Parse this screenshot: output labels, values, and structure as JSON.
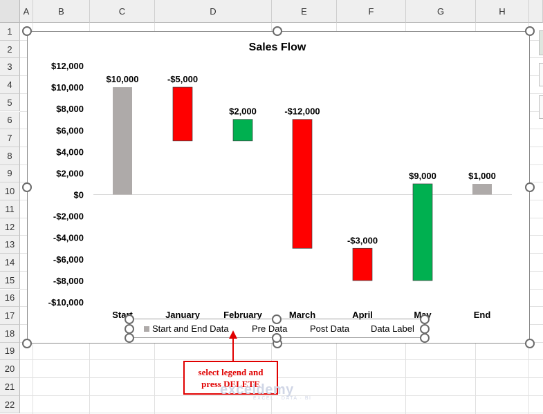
{
  "spreadsheet": {
    "columns": [
      "A",
      "B",
      "C",
      "D",
      "E",
      "F",
      "G",
      "H"
    ],
    "rows": [
      "1",
      "2",
      "3",
      "4",
      "5",
      "6",
      "7",
      "8",
      "9",
      "10",
      "11",
      "12",
      "13",
      "14",
      "15",
      "16",
      "17",
      "18",
      "19",
      "20",
      "21",
      "22"
    ]
  },
  "chart": {
    "title": "Sales Flow",
    "legend": [
      "Start and End Data",
      "Pre Data",
      "Post Data",
      "Data Label"
    ],
    "colors": {
      "total": "#aeaaa9",
      "negative": "#ff0000",
      "positive": "#00b050",
      "baseline": "#d9d9d9"
    }
  },
  "chart_data": {
    "type": "bar",
    "categories": [
      "Start",
      "January",
      "February",
      "March",
      "April",
      "May",
      "End"
    ],
    "bars": [
      {
        "category": "Start",
        "from": 0,
        "to": 10000,
        "kind": "total",
        "label": "$10,000"
      },
      {
        "category": "January",
        "from": 5000,
        "to": 10000,
        "kind": "negative",
        "label": "-$5,000"
      },
      {
        "category": "February",
        "from": 5000,
        "to": 7000,
        "kind": "positive",
        "label": "$2,000"
      },
      {
        "category": "March",
        "from": -5000,
        "to": 7000,
        "kind": "negative",
        "label": "-$12,000"
      },
      {
        "category": "April",
        "from": -8000,
        "to": -5000,
        "kind": "negative",
        "label": "-$3,000"
      },
      {
        "category": "May",
        "from": -8000,
        "to": 1000,
        "kind": "positive",
        "label": "$9,000"
      },
      {
        "category": "End",
        "from": 0,
        "to": 1000,
        "kind": "total",
        "label": "$1,000"
      }
    ],
    "yticks": [
      12000,
      10000,
      8000,
      6000,
      4000,
      2000,
      0,
      -2000,
      -4000,
      -6000,
      -8000,
      -10000
    ],
    "ytick_labels": [
      "$12,000",
      "$10,000",
      "$8,000",
      "$6,000",
      "$4,000",
      "$2,000",
      "$0",
      "-$2,000",
      "-$4,000",
      "-$6,000",
      "-$8,000",
      "-$10,000"
    ],
    "ylim": [
      -10000,
      12000
    ],
    "title": "Sales Flow",
    "legend_position": "bottom"
  },
  "annotation": {
    "callout_line1": "select legend and",
    "callout_line2": "press DELETE"
  },
  "watermark": {
    "name": "exceldemy",
    "tagline": "EXCEL · DATA · BI"
  }
}
